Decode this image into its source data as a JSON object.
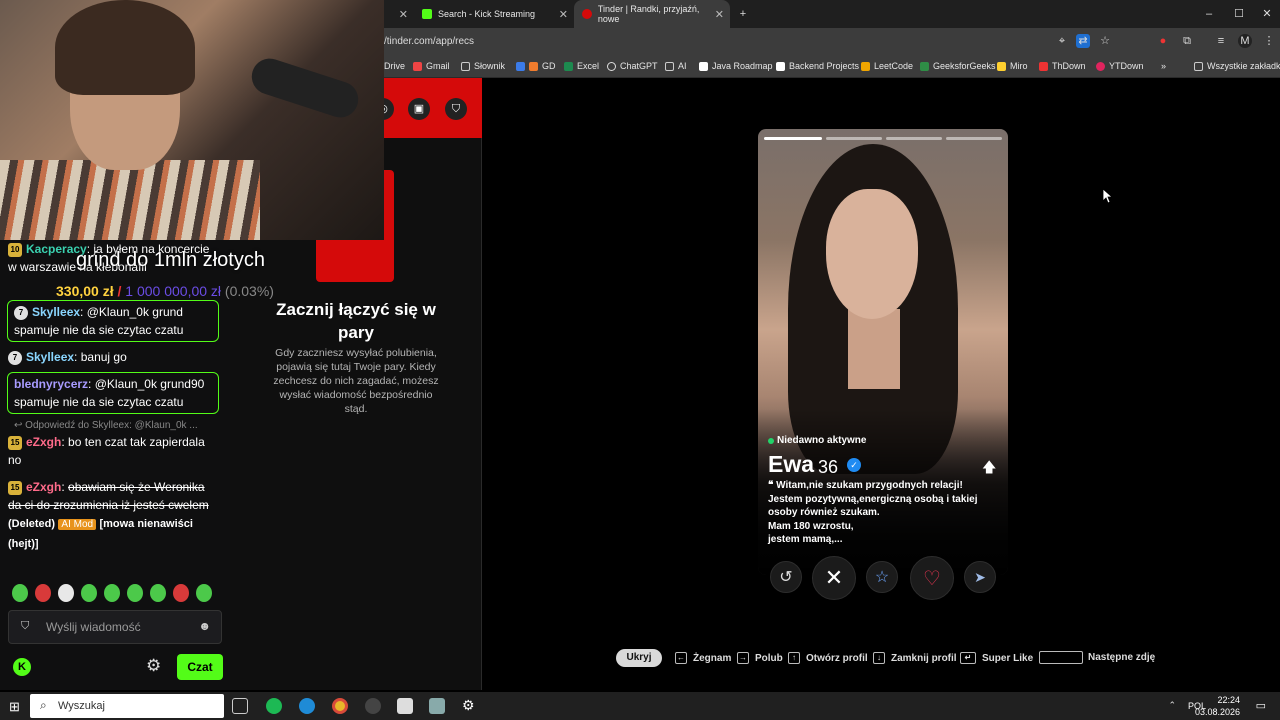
{
  "browser": {
    "tabs": [
      {
        "label": "Search - Kick Streaming",
        "color": "#53fc18"
      },
      {
        "label": "Tinder | Randki, przyjaźń, nowe",
        "color": "#d50a0a"
      }
    ],
    "url": "/tinder.com/app/recs",
    "bookmarks": [
      "Drive",
      "Gmail",
      "Słownik",
      "GD",
      "Excel",
      "ChatGPT",
      "AI",
      "Java Roadmap",
      "Backend Projects",
      "LeetCode",
      "GeeksforGeeks",
      "Miro",
      "ThDown",
      "YTDown",
      "Wszystkie zakładki"
    ],
    "profile_initial": "M"
  },
  "overlay": {
    "goal_title": "grind do 1mln złotych",
    "goal_current": "330,00 zł",
    "goal_separator": "/",
    "goal_target": "1 000 000,00 zł",
    "goal_percent": "(0.03%)"
  },
  "tinder_side": {
    "title": "Zacznij łączyć się w pary",
    "description": "Gdy zaczniesz wysyłać polubienia, pojawią się tutaj Twoje pary. Kiedy zechcesz do nich zagadać, możesz wysłać wiadomość bezpośrednio stąd."
  },
  "chat": {
    "messages": [
      {
        "badge": "10",
        "user": "Kacperacy",
        "color": "#3ad1b0",
        "text": "ja byłem na koncercie w warszawie na kłebonafii"
      },
      {
        "badge": "7",
        "user": "Skylleex",
        "color": "#8ad6ff",
        "text": "@Klaun_0k grund spamuje nie da sie czytac czatu"
      },
      {
        "badge": "7",
        "user": "Skylleex",
        "color": "#8ad6ff",
        "text": "banuj go"
      },
      {
        "badge": "",
        "user": "blednyrycerz",
        "color": "#a89bff",
        "text": "@Klaun_0k grund90 spamuje nie da sie czytac czatu"
      },
      {
        "badge": "15",
        "user": "eZxgh",
        "color": "#ff6b8a",
        "text": "bo ten czat tak zapierdala no"
      },
      {
        "badge": "15",
        "user": "eZxgh",
        "color": "#ff6b8a",
        "text": "obawiam się że Weronika da ci do zrozumienia iż jesteś cwelem"
      }
    ],
    "reply_hint": "Odpowiedź do Skylleex: @Klaun_0k ...",
    "deleted_label": "(Deleted)",
    "ai_mod_label": "AI Mod",
    "mod_reason": "[mowa nienawiści (hejt)]",
    "input_placeholder": "Wyślij wiadomość",
    "send_label": "Czat"
  },
  "card": {
    "active_status": "Niedawno aktywne",
    "name": "Ewa",
    "age": "36",
    "bio_lines": [
      "Witam,nie szukam przygodnych relacji! Jestem pozytywną,energiczną osobą i takiej osoby również szukam.",
      "Mam 180 wzrostu,",
      "jestem mamą,..."
    ]
  },
  "shortcuts": {
    "hide": "Ukryj",
    "items": [
      "Żegnam",
      "Polub",
      "Otwórz profil",
      "Zamknij profil",
      "Super Like",
      "Następne zdję"
    ]
  },
  "taskbar": {
    "search_placeholder": "Wyszukaj",
    "language": "POL",
    "time": "22:24",
    "date": "03.08.2026"
  }
}
